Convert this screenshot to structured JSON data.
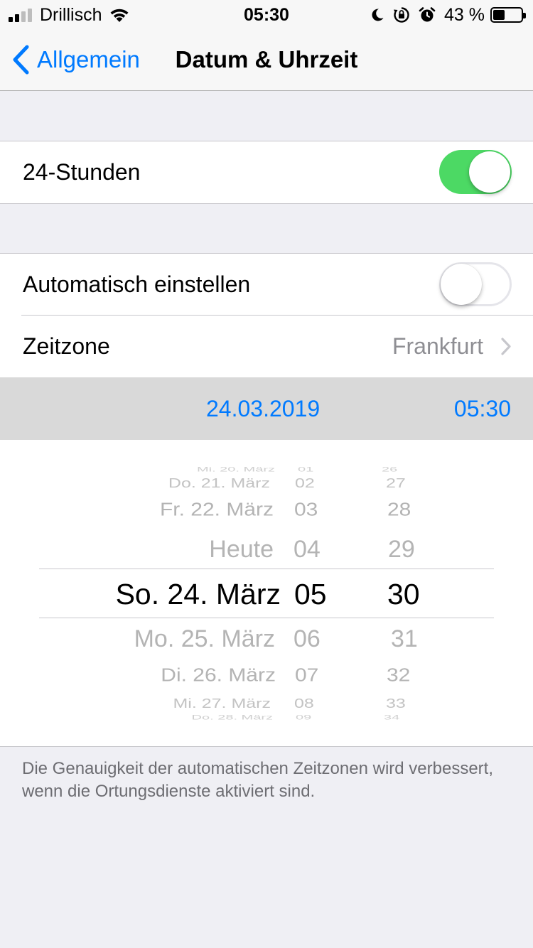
{
  "status_bar": {
    "carrier": "Drillisch",
    "time": "05:30",
    "battery_percent": "43 %",
    "battery_level": 0.43,
    "signal_bars_active": 2,
    "signal_bars_total": 4,
    "icons": [
      "wifi-icon",
      "moon-icon",
      "rotation-lock-icon",
      "alarm-icon",
      "battery-icon"
    ]
  },
  "nav": {
    "back_label": "Allgemein",
    "title": "Datum & Uhrzeit"
  },
  "settings": {
    "hour24": {
      "label": "24-Stunden",
      "on": true
    },
    "auto_set": {
      "label": "Automatisch einstellen",
      "on": false
    },
    "timezone": {
      "label": "Zeitzone",
      "value": "Frankfurt"
    }
  },
  "datetime": {
    "date": "24.03.2019",
    "time": "05:30"
  },
  "picker": {
    "days": {
      "r0": "Mi. 20. März",
      "r1": "Do. 21. März",
      "r2": "Fr. 22. März",
      "r3": "Heute",
      "r4": "So. 24. März",
      "r5": "Mo. 25. März",
      "r6": "Di. 26. März",
      "r7": "Mi. 27. März",
      "r8": "Do. 28. März"
    },
    "hours": {
      "r0": "01",
      "r1": "02",
      "r2": "03",
      "r3": "04",
      "r4": "05",
      "r5": "06",
      "r6": "07",
      "r7": "08",
      "r8": "09"
    },
    "minutes": {
      "r0": "26",
      "r1": "27",
      "r2": "28",
      "r3": "29",
      "r4": "30",
      "r5": "31",
      "r6": "32",
      "r7": "33",
      "r8": "34"
    }
  },
  "footer": {
    "note": "Die Genauigkeit der automatischen Zeitzonen wird verbessert, wenn die Ortungsdienste aktiviert sind."
  },
  "colors": {
    "accent": "#007aff",
    "switch_on": "#4cd964",
    "background": "#efeff4"
  }
}
